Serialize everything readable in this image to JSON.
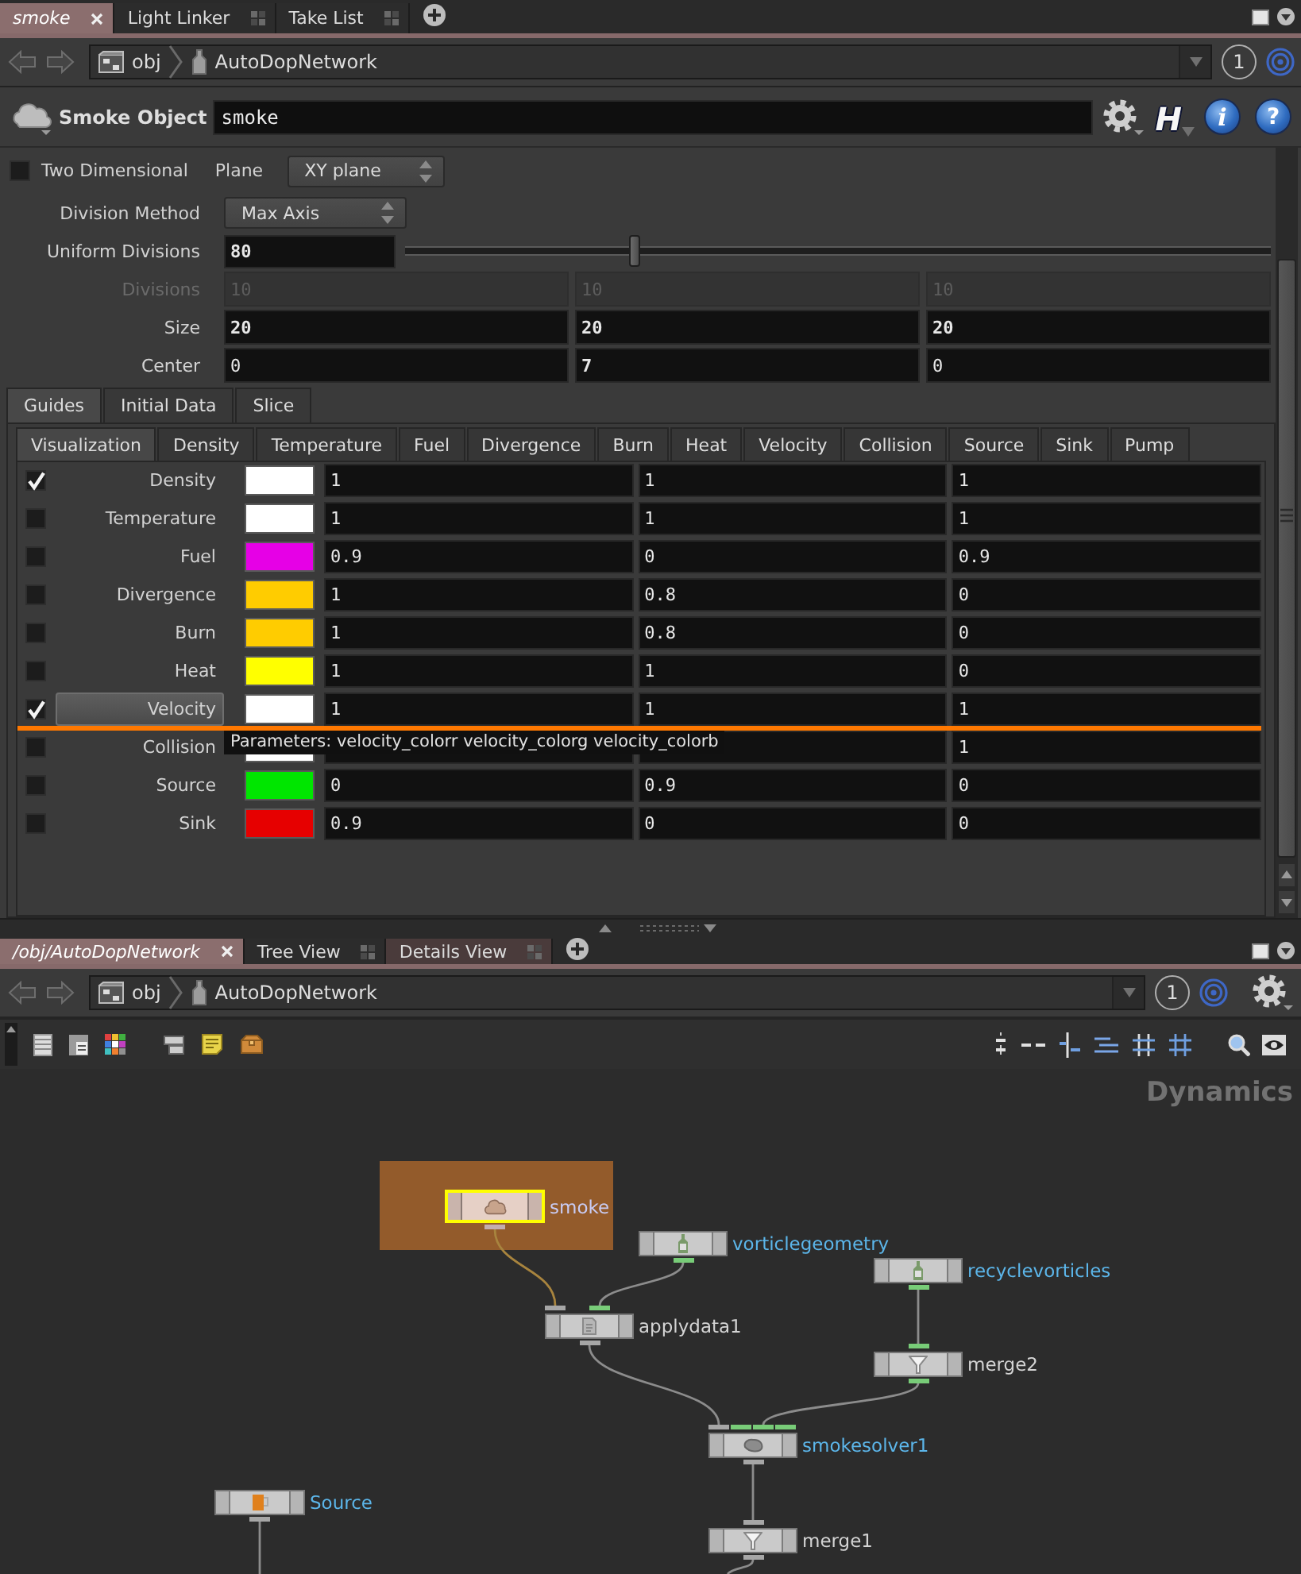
{
  "parameter_pane": {
    "tabs": [
      {
        "label": "smoke",
        "selected": true,
        "hovered": false
      },
      {
        "label": "Light Linker",
        "selected": false,
        "hovered": false
      },
      {
        "label": "Take List",
        "selected": false,
        "hovered": false
      }
    ],
    "path": {
      "items": [
        {
          "label": "obj",
          "kind": "network"
        },
        {
          "label": "AutoDopNetwork",
          "kind": "dop"
        }
      ],
      "link_number": "1"
    },
    "header": {
      "type_label": "Smoke Object",
      "name": "smoke",
      "type_button": "H",
      "info_button": "i",
      "help_button": "?"
    },
    "two_dimensional": {
      "label": "Two Dimensional",
      "checked": false
    },
    "plane": {
      "label": "Plane",
      "value": "XY plane"
    },
    "division_method": {
      "label": "Division Method",
      "value": "Max Axis"
    },
    "uniform_divisions": {
      "label": "Uniform Divisions",
      "value": "80",
      "modified": true,
      "level": 0.265
    },
    "vectors": [
      {
        "label": "Divisions",
        "disabled": true,
        "values": [
          {
            "text": "10",
            "modified": false
          },
          {
            "text": "10",
            "modified": false
          },
          {
            "text": "10",
            "modified": false
          }
        ]
      },
      {
        "label": "Size",
        "disabled": false,
        "values": [
          {
            "text": "20",
            "modified": true
          },
          {
            "text": "20",
            "modified": true
          },
          {
            "text": "20",
            "modified": true
          }
        ]
      },
      {
        "label": "Center",
        "disabled": false,
        "values": [
          {
            "text": "0",
            "modified": false
          },
          {
            "text": "7",
            "modified": true
          },
          {
            "text": "0",
            "modified": false
          }
        ]
      }
    ],
    "section_tabs": [
      {
        "label": "Guides",
        "selected": true
      },
      {
        "label": "Initial Data",
        "selected": false
      },
      {
        "label": "Slice",
        "selected": false
      }
    ],
    "guide_tabs": [
      {
        "label": "Visualization",
        "selected": true
      },
      {
        "label": "Density",
        "selected": false
      },
      {
        "label": "Temperature",
        "selected": false
      },
      {
        "label": "Fuel",
        "selected": false
      },
      {
        "label": "Divergence",
        "selected": false
      },
      {
        "label": "Burn",
        "selected": false
      },
      {
        "label": "Heat",
        "selected": false
      },
      {
        "label": "Velocity",
        "selected": false
      },
      {
        "label": "Collision",
        "selected": false
      },
      {
        "label": "Source",
        "selected": false
      },
      {
        "label": "Sink",
        "selected": false
      },
      {
        "label": "Pump",
        "selected": false
      }
    ],
    "guide_rows": [
      {
        "label": "Density",
        "checked": true,
        "highlighted": false,
        "color": "#ffffff",
        "red": "1",
        "green": "1",
        "blue": "1"
      },
      {
        "label": "Temperature",
        "checked": false,
        "highlighted": false,
        "color": "#ffffff",
        "red": "1",
        "green": "1",
        "blue": "1"
      },
      {
        "label": "Fuel",
        "checked": false,
        "highlighted": false,
        "color": "#e600e6",
        "red": "0.9",
        "green": "0",
        "blue": "0.9"
      },
      {
        "label": "Divergence",
        "checked": false,
        "highlighted": false,
        "color": "#ffcc00",
        "red": "1",
        "green": "0.8",
        "blue": "0"
      },
      {
        "label": "Burn",
        "checked": false,
        "highlighted": false,
        "color": "#ffcc00",
        "red": "1",
        "green": "0.8",
        "blue": "0"
      },
      {
        "label": "Heat",
        "checked": false,
        "highlighted": false,
        "color": "#ffff00",
        "red": "1",
        "green": "1",
        "blue": "0"
      },
      {
        "label": "Velocity",
        "checked": true,
        "highlighted": true,
        "color": "#ffffff",
        "red": "1",
        "green": "1",
        "blue": "1"
      },
      {
        "label": "Collision",
        "checked": false,
        "highlighted": false,
        "color": "#ffffff",
        "blue": "1"
      },
      {
        "label": "Source",
        "checked": false,
        "highlighted": false,
        "color": "#00e600",
        "red": "0",
        "green": "0.9",
        "blue": "0"
      },
      {
        "label": "Sink",
        "checked": false,
        "highlighted": false,
        "color": "#e60000",
        "red": "0.9",
        "green": "0",
        "blue": "0"
      }
    ],
    "tooltip": "Parameters: velocity_colorr velocity_colorg velocity_colorb"
  },
  "network_pane": {
    "tabs": [
      {
        "label": "/obj/AutoDopNetwork",
        "selected": true,
        "hovered": false
      },
      {
        "label": "Tree View",
        "selected": false,
        "hovered": false
      },
      {
        "label": "Details View",
        "selected": false,
        "hovered": true
      }
    ],
    "path": {
      "items": [
        {
          "label": "obj",
          "kind": "network"
        },
        {
          "label": "AutoDopNetwork",
          "kind": "dop"
        }
      ],
      "link_number": "1"
    },
    "context_label": "Dynamics",
    "nodes": [
      {
        "name": "smoke",
        "kind": "object",
        "selected": true,
        "color": "#c9ccf4",
        "outputs": [
          {
            "color": "#c4aeae"
          }
        ]
      },
      {
        "name": "vorticlegeometry",
        "kind": "geometry",
        "selected": false,
        "color": "#5cb6ea",
        "outputs": [
          {
            "color": "#78cc78"
          }
        ]
      },
      {
        "name": "recyclevorticles",
        "kind": "geometry",
        "selected": false,
        "color": "#5cb6ea",
        "outputs": [
          {
            "color": "#78cc78"
          }
        ]
      },
      {
        "name": "applydata1",
        "kind": "apply",
        "selected": false,
        "color": "#d4d4d4",
        "inputs": [
          {
            "color": "#a6a6a6"
          },
          {
            "color": "#78cc78"
          }
        ],
        "outputs": [
          {
            "color": "#a6a6a6"
          }
        ]
      },
      {
        "name": "merge2",
        "kind": "merge",
        "selected": false,
        "color": "#d4d4d4",
        "inputs": [
          {
            "color": "#78cc78"
          }
        ],
        "outputs": [
          {
            "color": "#78cc78"
          }
        ]
      },
      {
        "name": "smokesolver1",
        "kind": "solver",
        "selected": false,
        "color": "#5cb6ea",
        "inputs": [
          {
            "color": "#a6a6a6"
          },
          {
            "color": "#78cc78"
          },
          {
            "color": "#78cc78"
          },
          {
            "color": "#78cc78"
          }
        ],
        "outputs": [
          {
            "color": "#a6a6a6"
          }
        ]
      },
      {
        "name": "Source",
        "kind": "source",
        "selected": false,
        "color": "#5cb6ea",
        "outputs": [
          {
            "color": "#a6a6a6"
          }
        ]
      },
      {
        "name": "merge1",
        "kind": "merge",
        "selected": false,
        "color": "#d4d4d4",
        "inputs": [
          {
            "color": "#a6a6a6"
          }
        ],
        "outputs": [
          {
            "color": "#a6a6a6"
          }
        ]
      }
    ]
  }
}
